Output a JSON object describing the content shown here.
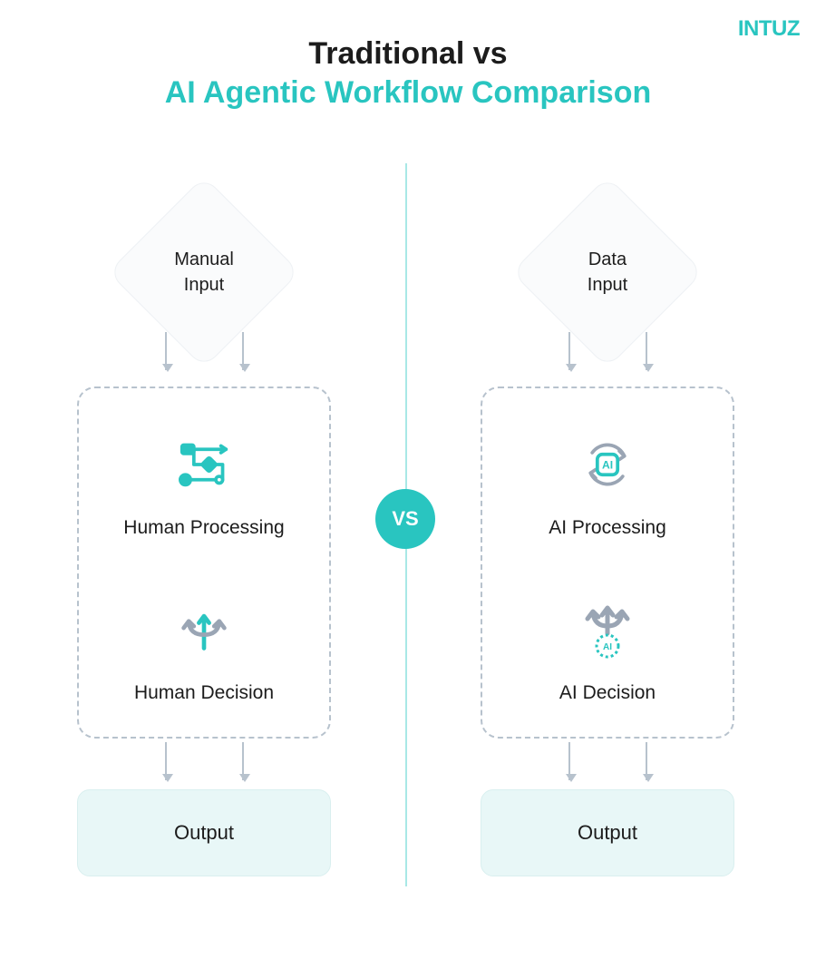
{
  "logo": "INTUZ",
  "title_line1": "Traditional vs",
  "title_line2": "AI Agentic Workflow Comparison",
  "vs_label": "VS",
  "left": {
    "input": "Manual\nInput",
    "step1": "Human Processing",
    "step2": "Human Decision",
    "output": "Output"
  },
  "right": {
    "input": "Data\nInput",
    "step1": "AI Processing",
    "step2": "AI Decision",
    "output": "Output"
  }
}
